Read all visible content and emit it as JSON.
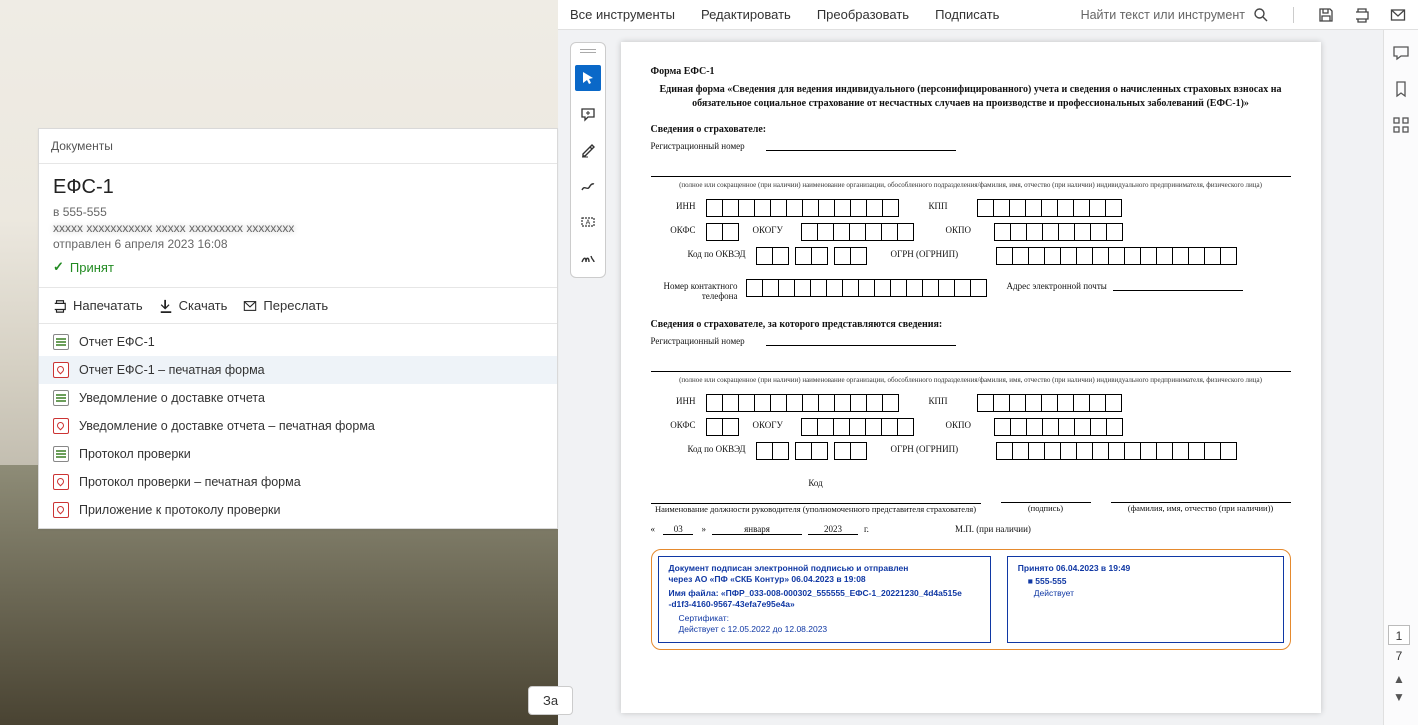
{
  "documentsPanel": {
    "header": "Документы",
    "title": "ЕФС-1",
    "recipient": "в 555-555",
    "sentLine": "отправлен 6 апреля 2023 16:08",
    "status": "Принят",
    "actions": {
      "print": "Напечатать",
      "download": "Скачать",
      "forward": "Переслать"
    },
    "files": [
      {
        "icon": "doc",
        "label": "Отчет ЕФС-1"
      },
      {
        "icon": "pdf",
        "label": "Отчет ЕФС-1 – печатная форма",
        "selected": true
      },
      {
        "icon": "doc",
        "label": "Уведомление о доставке отчета"
      },
      {
        "icon": "pdf",
        "label": "Уведомление о доставке отчета – печатная форма"
      },
      {
        "icon": "doc",
        "label": "Протокол проверки"
      },
      {
        "icon": "pdf",
        "label": "Протокол проверки – печатная форма"
      },
      {
        "icon": "pdf",
        "label": "Приложение к протоколу проверки"
      }
    ]
  },
  "closeBtn": "За",
  "pdfViewer": {
    "menu": {
      "all": "Все инструменты",
      "edit": "Редактировать",
      "convert": "Преобразовать",
      "sign": "Подписать"
    },
    "searchPlaceholder": "Найти текст или инструмент",
    "page": {
      "current": "1",
      "total": "7"
    }
  },
  "form": {
    "tag": "Форма ЕФС-1",
    "title": "Единая форма «Сведения для ведения индивидуального (персонифицированного) учета и сведения о начисленных страховых взносах на обязательное социальное страхование от несчастных случаев на производстве и профессиональных заболеваний (ЕФС-1)»",
    "section1": "Сведения о страхователе:",
    "section2": "Сведения о страхователе, за которого представляются сведения:",
    "labels": {
      "regNo": "Регистрационный номер",
      "inn": "ИНН",
      "kpp": "КПП",
      "okfs": "ОКФС",
      "okogu": "ОКОГУ",
      "okpo": "ОКПО",
      "okved": "Код по ОКВЭД",
      "ogrn": "ОГРН (ОГРНИП)",
      "phone": "Номер контактного телефона",
      "email": "Адрес электронной почты",
      "code": "Код",
      "positionCaption": "Наименование должности руководителя (уполномоченного представителя страхователя)",
      "signCaption": "(подпись)",
      "fioCaption": "(фамилия, имя, отчество (при наличии))",
      "orgCaption": "(полное или сокращенное (при наличии) наименование организации, обособленного подразделения/фамилия, имя, отчество (при наличии) индивидуального предпринимателя, физического лица)",
      "mp": "М.П. (при наличии)"
    },
    "date": {
      "day": "03",
      "month": "января",
      "year": "2023",
      "g": "г."
    },
    "stamps": {
      "s1": {
        "l1": "Документ подписан электронной подписью и отправлен",
        "l2": "через АО «ПФ «СКБ Контур» 06.04.2023 в 19:08",
        "l3": "Имя файла: «ПФР_033-008-000302_555555_ЕФС-1_20221230_4d4a515e",
        "l4": "-d1f3-4160-9567-43efa7e95e4a»",
        "l5": "Сертификат:",
        "l6": "Действует с 12.05.2022 до 12.08.2023"
      },
      "s2": {
        "l1": "Принято 06.04.2023 в 19:49",
        "l2": "555-555",
        "l3": "Действует"
      }
    }
  }
}
